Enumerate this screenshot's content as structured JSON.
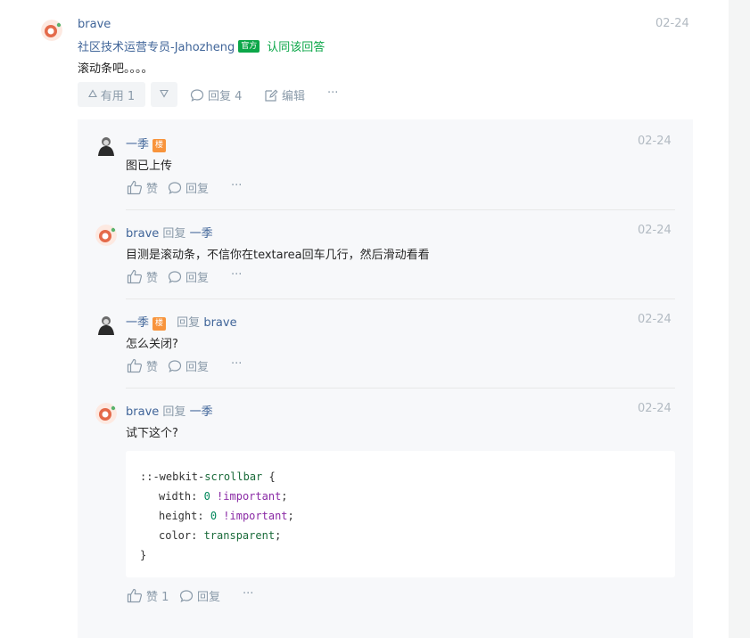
{
  "main": {
    "author": "brave",
    "date": "02-24",
    "title": "社区技术运营专员-Jahozheng",
    "official_badge": "官方",
    "accept_text": "认同该回答",
    "content": "滚动条吧。。。。",
    "useful_label": "有用 1",
    "reply_label": "回复 4",
    "edit_label": "编辑",
    "more_label": "···"
  },
  "replies": [
    {
      "author": "一季",
      "floor_badge": "楼",
      "date": "02-24",
      "content": "图已上传",
      "like_label": "赞",
      "reply_label": "回复",
      "more_label": "···"
    },
    {
      "author": "brave",
      "reply_word": "回复",
      "reply_to": "一季",
      "date": "02-24",
      "content": "目测是滚动条，不信你在textarea回车几行，然后滑动看看",
      "like_label": "赞",
      "reply_label": "回复",
      "more_label": "···"
    },
    {
      "author": "一季",
      "floor_badge": "楼",
      "reply_word": "回复",
      "reply_to": "brave",
      "date": "02-24",
      "content": "怎么关闭?",
      "like_label": "赞",
      "reply_label": "回复",
      "more_label": "···"
    },
    {
      "author": "brave",
      "reply_word": "回复",
      "reply_to": "一季",
      "date": "02-24",
      "content": "试下这个?",
      "code": {
        "selector_prefix": "::-webkit-",
        "selector_name": "scrollbar",
        "open_brace": " {",
        "width_prop": "width",
        "width_num": "0",
        "width_imp": "!important",
        "height_prop": "height",
        "height_num": "0",
        "height_imp": "!important",
        "color_prop": "color",
        "color_val": "transparent",
        "close_brace": "}"
      },
      "like_label": "赞 1",
      "reply_label": "回复",
      "more_label": "···"
    }
  ],
  "colors": {
    "name": "#406599",
    "muted": "#8a9aa9",
    "date": "#b2bac2",
    "official": "#0ca749",
    "floor_badge": "#f8943c",
    "panel": "#f7f8fa"
  },
  "icons": {
    "up": "triangle-up-icon",
    "down": "triangle-down-icon",
    "comment": "comment-bubble-icon",
    "edit": "edit-pencil-icon",
    "like": "thumbs-up-icon"
  }
}
